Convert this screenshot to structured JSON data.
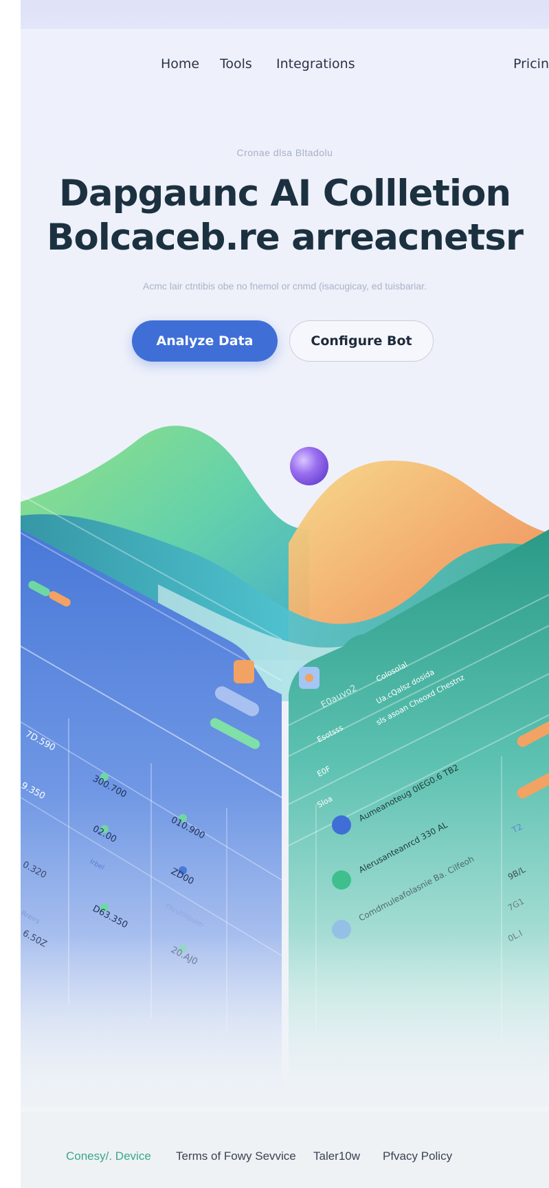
{
  "nav": {
    "items": [
      {
        "label": "Home"
      },
      {
        "label": "Tools"
      },
      {
        "label": "Integrations"
      },
      {
        "label": "Pricin"
      }
    ]
  },
  "hero": {
    "eyebrow": "Cronae dlsa Bltadolu",
    "title_line1": "Dapgaunc AI Collletion",
    "title_line2": "Bolcaceb.re arreacnetsr",
    "subtitle": "Acmc lair ctntibis obe no fnemol or cnmd (isacugicay, ed tuisbariar.",
    "primary_button": "Analyze Data",
    "secondary_button": "Configure Bot"
  },
  "dashboard_left": {
    "values": [
      "7D.590",
      "9.350",
      "0.320",
      "6.50Z",
      "300.700",
      "02.00",
      "D63.350",
      "010.900",
      "ZD00",
      "20.AJ0"
    ],
    "labels": [
      "Irbel",
      "Rreirs",
      "Fhrutlitbulm"
    ]
  },
  "dashboard_right": {
    "header": [
      "Colosolal",
      "Ua.cQalsz dosida",
      "sls asoan Cheoxd Chestnz"
    ],
    "side_labels": [
      "E0auvo2",
      "Esotsss",
      "E0F",
      "Sloa"
    ],
    "rows": [
      {
        "text": "Aumeanoteug 0IEG0.6 TB2"
      },
      {
        "text": "Alerusanteanrcd 330 AL"
      },
      {
        "text": "Comdmuleafolasnie Ba. Cilfeoh"
      }
    ],
    "right_values": [
      "T2",
      "9B/L",
      "7G1",
      "0L.I"
    ]
  },
  "footer": {
    "links": [
      {
        "label": "Conesy/. Device"
      },
      {
        "label": "Terms of Fowy Sevvice"
      },
      {
        "label": "Taler10w"
      },
      {
        "label": "Pfvacy Policy"
      }
    ]
  },
  "colors": {
    "primary_button": "#3f6fd6",
    "title": "#1c3140",
    "footer_accent_link": "#3aa58c",
    "wave_green": "#7fd88a",
    "wave_orange": "#f2a263",
    "orb_purple": "#9a6ff0",
    "panel_blue": "#4f7fd8",
    "panel_teal": "#2f9e8c"
  }
}
